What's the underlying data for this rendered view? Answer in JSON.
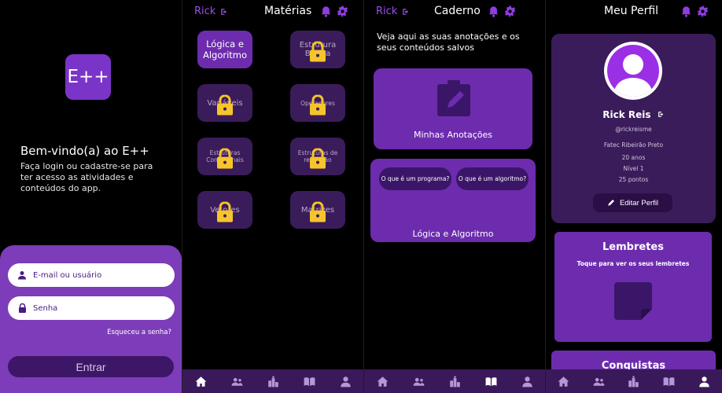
{
  "login": {
    "logo_text": "E++",
    "welcome_title": "Bem-vindo(a) ao E++",
    "welcome_sub": "Faça login ou cadastre-se para ter acesso as atividades e conteúdos do app.",
    "user_placeholder": "E-mail ou usuário",
    "password_placeholder": "Senha",
    "forgot": "Esqueceu a senha?",
    "enter": "Entrar"
  },
  "header": {
    "user": "Rick"
  },
  "subjects": {
    "title": "Matérias",
    "items": [
      {
        "label": "Lógica e Algoritmo",
        "locked": false
      },
      {
        "label": "Estrutura Básica",
        "locked": true
      },
      {
        "label": "Variáveis",
        "locked": true
      },
      {
        "label": "Operadores",
        "locked": true
      },
      {
        "label": "Estruturas Condicionais",
        "locked": true
      },
      {
        "label": "Estruturas de repetição",
        "locked": true
      },
      {
        "label": "Vetores",
        "locked": true
      },
      {
        "label": "Matrizes",
        "locked": true
      }
    ]
  },
  "notebook": {
    "title": "Caderno",
    "description": "Veja aqui as suas anotações e os seus conteúdos salvos",
    "notes_card": "Minhas Anotações",
    "course_card": "Lógica e Algoritmo",
    "pill1": "O que é um programa?",
    "pill2": "O que é um algoritmo?"
  },
  "profile": {
    "title": "Meu Perfil",
    "name": "Rick Reis",
    "handle": "@rickreisme",
    "school": "Fatec Ribeirão Preto",
    "age": "20 anos",
    "level": "Nível 1",
    "points": "25 pontos",
    "edit": "Editar Perfil",
    "reminders_title": "Lembretes",
    "reminders_sub": "Toque para ver os seus lembretes",
    "achievements_title": "Conquistas"
  },
  "colors": {
    "accent": "#6d2cae",
    "dark_purple": "#3b1c5a",
    "link": "#9a4ef0",
    "lock": "#f6c52c"
  },
  "nav_icons": [
    "home-icon",
    "community-icon",
    "ranking-icon",
    "notebook-icon",
    "profile-icon"
  ]
}
